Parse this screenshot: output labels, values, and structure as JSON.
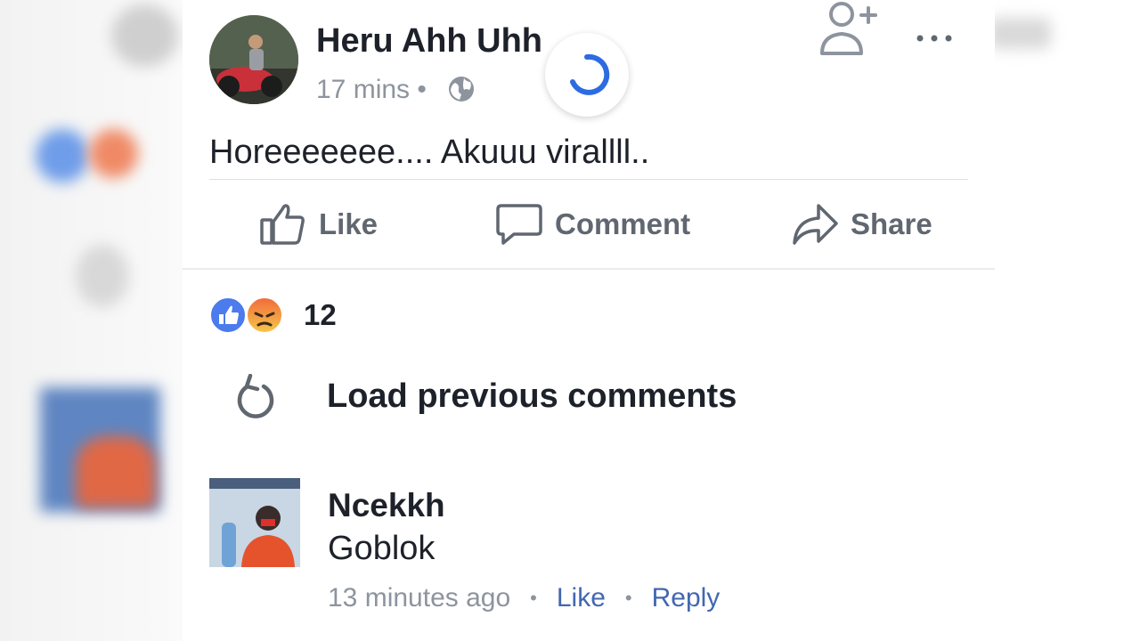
{
  "post": {
    "author": "Heru Ahh Uhh",
    "time": "17 mins",
    "separator": "•",
    "text": "Horeeeeeee.... Akuuu virallll..",
    "actions": {
      "like": "Like",
      "comment": "Comment",
      "share": "Share"
    },
    "reactions": {
      "count": "12",
      "types": [
        "like",
        "angry"
      ]
    }
  },
  "comments": {
    "load_previous": "Load previous comments",
    "items": [
      {
        "author": "Ncekkh",
        "text": "Goblok",
        "time": "13 minutes ago",
        "like_label": "Like",
        "reply_label": "Reply",
        "dot": "•"
      }
    ]
  },
  "colors": {
    "link": "#4267b2",
    "like_reaction": "#4b7bec",
    "angry_reaction_top": "#f06a3a",
    "angry_reaction_bottom": "#f6c84a",
    "spinner": "#2d6be0"
  },
  "icons": {
    "add_friend": "add-friend-icon",
    "more": "more-icon",
    "globe": "globe-icon",
    "like": "thumbs-up-icon",
    "comment": "comment-bubble-icon",
    "share": "share-arrow-icon",
    "load_previous": "refresh-icon"
  }
}
